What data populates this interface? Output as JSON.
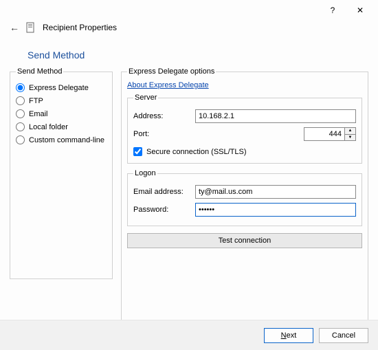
{
  "titlebar": {
    "help": "?",
    "close": "✕"
  },
  "header": {
    "title": "Recipient Properties"
  },
  "section_title": "Send Method",
  "send_method": {
    "legend": "Send Method",
    "options": {
      "express": "Express Delegate",
      "ftp": "FTP",
      "email": "Email",
      "local": "Local folder",
      "custom": "Custom command-line"
    },
    "selected": "express"
  },
  "right": {
    "legend": "Express Delegate options",
    "about_link": "About Express Delegate",
    "server": {
      "legend": "Server",
      "address_label": "Address:",
      "address_value": "10.168.2.1",
      "port_label": "Port:",
      "port_value": "444",
      "secure_label": "Secure connection (SSL/TLS)",
      "secure_checked": true
    },
    "logon": {
      "legend": "Logon",
      "email_label": "Email address:",
      "email_value": "ty@mail.us.com",
      "password_label": "Password:",
      "password_value": "••••••"
    },
    "test_btn": "Test connection"
  },
  "footer": {
    "next": "Next",
    "cancel": "Cancel"
  }
}
